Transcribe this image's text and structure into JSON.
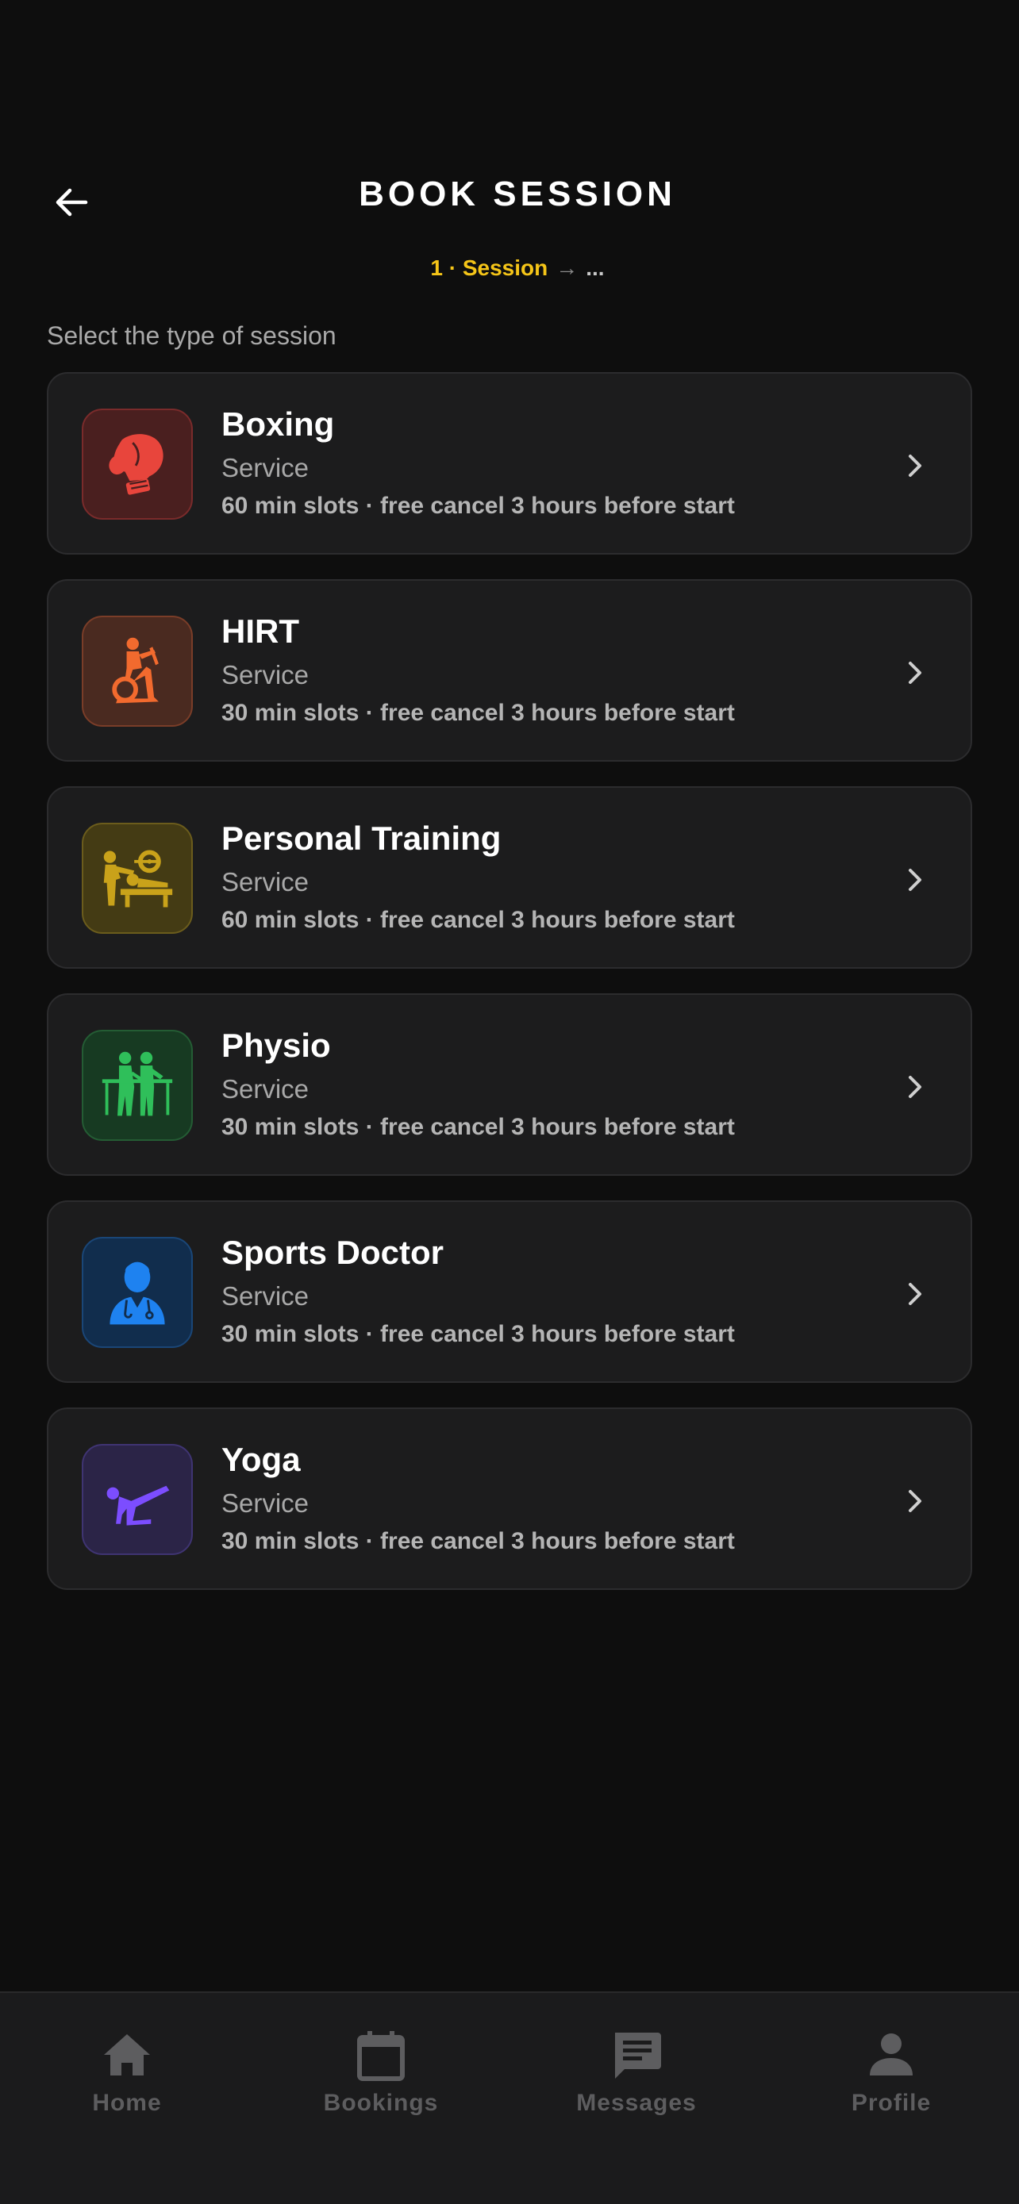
{
  "header": {
    "title": "BOOK SESSION"
  },
  "steps": {
    "current": "1 · Session",
    "arrow": "→",
    "next": "..."
  },
  "prompt": "Select the type of session",
  "services": [
    {
      "name": "Boxing",
      "type": "Service",
      "meta": "60 min slots · free cancel 3 hours before start",
      "icon": "boxing-glove-icon",
      "color": "#e8453c",
      "bg": "#4a1f1f"
    },
    {
      "name": "HIRT",
      "type": "Service",
      "meta": "30 min slots · free cancel 3 hours before start",
      "icon": "exercise-bike-icon",
      "color": "#f26a2e",
      "bg": "#4a2a20"
    },
    {
      "name": "Personal Training",
      "type": "Service",
      "meta": "60 min slots · free cancel 3 hours before start",
      "icon": "bench-press-icon",
      "color": "#c9a21a",
      "bg": "#443b14"
    },
    {
      "name": "Physio",
      "type": "Service",
      "meta": "30 min slots · free cancel 3 hours before start",
      "icon": "physiotherapy-icon",
      "color": "#2fbf5a",
      "bg": "#173a22"
    },
    {
      "name": "Sports Doctor",
      "type": "Service",
      "meta": "30 min slots · free cancel 3 hours before start",
      "icon": "doctor-icon",
      "color": "#1e82f0",
      "bg": "#112d4d"
    },
    {
      "name": "Yoga",
      "type": "Service",
      "meta": "30 min slots · free cancel 3 hours before start",
      "icon": "yoga-pose-icon",
      "color": "#7c4dff",
      "bg": "#2b2447"
    }
  ],
  "tabbar": {
    "home": "Home",
    "bookings": "Bookings",
    "messages": "Messages",
    "profile": "Profile"
  },
  "colors": {
    "accent": "#f5c518",
    "background": "#0e0e0e",
    "card": "#1c1c1d",
    "tab_inactive": "#5d5d5f"
  }
}
